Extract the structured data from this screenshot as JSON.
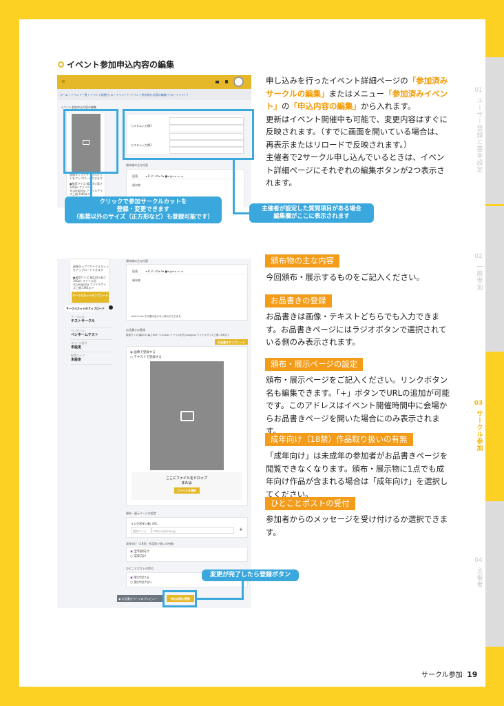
{
  "section_title": "イベント参加申込内容の編集",
  "side_tabs": [
    {
      "num": "01",
      "label": "ユーザー登録と基本設定",
      "active": false
    },
    {
      "num": "02",
      "label": "一般参加",
      "active": false
    },
    {
      "num": "03",
      "label": "サークル参加",
      "active": true
    },
    {
      "num": "04",
      "label": "主催者",
      "active": false
    }
  ],
  "intro": {
    "p1_a": "申し込みを行ったイベント詳細ページの",
    "p1_b": "「参加済みサークルの編集」",
    "p1_c": "またはメニュー",
    "p1_d": "「参加済みイベント」",
    "p1_e": "の",
    "p1_f": "「申込内容の編集」",
    "p1_g": "から入れます。",
    "p2": "更新はイベント開催中も可能で、変更内容はすぐに反映されます。（すでに画面を開いている場合は、再表示またはリロードで反映されます。）",
    "p3": "主催者で2サークル申し込んでいるときは、イベント詳細ページにそれぞれの編集ボタンが2つ表示されます。"
  },
  "sections": [
    {
      "heading": "頒布物の主な内容",
      "text": "今回頒布・展示するものをご記入ください。"
    },
    {
      "heading": "お品書きの登録",
      "text": "お品書きは画像・テキストどちらでも入力できます。お品書きページにはラジオボタンで選択されている側のみ表示されます。"
    },
    {
      "heading": "頒布・展示ページの設定",
      "text": "頒布・展示ページをご記入ください。リンクボタン名も編集できます。「+」ボタンでURLの追加が可能です。このアドレスはイベント開催時間中に会場からお品書きページを開いた場合にのみ表示されます。"
    },
    {
      "heading": "成年向け（18禁）作品取り扱いの有無",
      "text": "「成年向け」は未成年の参加者がお品書きページを閲覧できなくなります。頒布・展示物に1点でも成年向け作品が含まれる場合は「成年向け」を選択してください。"
    },
    {
      "heading": "ひとことポストの受付",
      "text": "参加者からのメッセージを受け付けるか選択できます。"
    }
  ],
  "callouts": {
    "cut": "クリックで参加サークルカットを\n登録・変更できます\n（推奨以外のサイズ（正方形など）も登録可能です）",
    "custom": "主催者が設定した質問項目がある場合\n編集欄がここに表示されます",
    "submit": "変更が完了したら登録ボタン"
  },
  "shot1": {
    "menu_icon": "≡",
    "breadcrumb": "ホーム / イベント一覧 / イベント詳細(テストイベント) / イベント参加申込内容の編集(テストイベント)",
    "form_title": "イベント参加申込内容の編集",
    "custom1": "カスタム入力欄1",
    "custom2": "カスタム入力欄2",
    "items_label": "頒布物の主な内容",
    "cut_note": "画像タップでサークルカットをアップロードできます",
    "cut_size": "●推奨サイズ:幅220×高さ300px ファイル形式:jpeg/png ファイルサイズ上限:1MBまで",
    "editor_style": "段落",
    "editor_placeholder": "頒布物"
  },
  "shot2": {
    "cut_note": "画像タップでサークルカットをアップロードできます",
    "cut_size": "●推奨サイズ:幅220×高さ300px ファイル形式:jpeg/png ファイルサイズ上限:1MBまで",
    "cut_template": "サークルカットテンプレート",
    "cut_upload": "サークルカットのアップロード",
    "fields": [
      {
        "label": "サークル名",
        "value": "テストサークル"
      },
      {
        "label": "ペンネーム",
        "value": "ペンネームテスト"
      },
      {
        "label": "スペース番号",
        "value": "未設定"
      },
      {
        "label": "配置マップ",
        "value": "未設定"
      }
    ],
    "items_label": "頒布物の主な内容",
    "editor_style": "段落",
    "editor_placeholder": "頒布物",
    "editor_note": "shift+Enterで行間の空かない改行ができます。",
    "menu_label": "お品書きの登録",
    "menu_note": "推奨サイズ:幅800×高さ800〜1,400px ファイル形式:jpeg/png ファイルサイズ上限:1MBまで",
    "menu_template": "お品書きテンプレート",
    "radio_image": "画像で登録する",
    "radio_text": "テキストで登録する",
    "drop_text": "ここにファイルをドロップ",
    "drop_or": "または",
    "select_file": "ファイルを選択",
    "page_label": "頒布・展示ページの設定",
    "link_label": "リンクボタン名",
    "link_url_label": "/ URL",
    "link_name": "頒布ページ",
    "link_url": "https://picrew.jp",
    "plus": "+",
    "adult_label": "成年向け（18禁）作品取り扱いの有無",
    "adult_all": "全年齢向け",
    "adult_r18": "成年向け",
    "post_label": "ひとことポストの受付",
    "post_yes": "受け付ける",
    "post_no": "受け付けない",
    "preview_btn": "お品書きページのプレビュー",
    "submit_btn": "申込内容の更新"
  },
  "footer": {
    "chapter": "サークル参加",
    "page": "19"
  }
}
